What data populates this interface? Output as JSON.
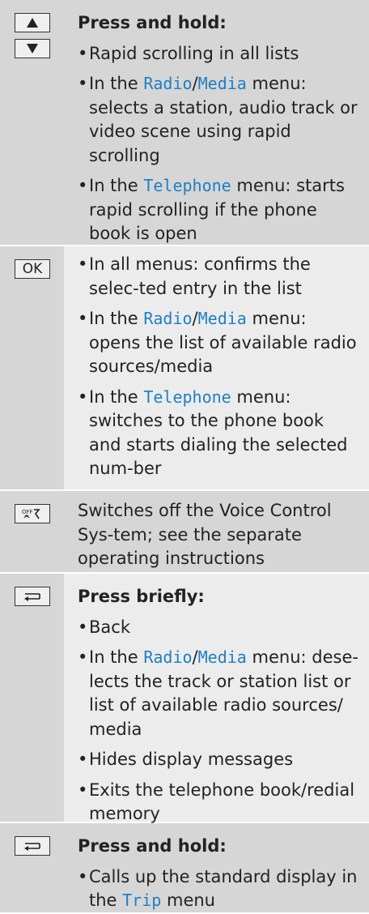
{
  "rows": [
    {
      "keys": [
        "up",
        "down"
      ],
      "heading": "Press and hold:",
      "items": [
        {
          "text": "Rapid scrolling in all lists"
        },
        {
          "pre": "In the ",
          "menu1": "Radio",
          "sep": "/",
          "menu2": "Media",
          "post": " menu: selects a station, audio track or video scene using rapid scrolling"
        },
        {
          "pre": "In the ",
          "menu1": "Telephone",
          "post": " menu: starts rapid scrolling if the phone book is open"
        }
      ]
    },
    {
      "key_label": "OK",
      "items": [
        {
          "text": "In all menus: confirms the selec-ted entry in the list"
        },
        {
          "pre": "In the ",
          "menu1": "Radio",
          "sep": "/",
          "menu2": "Media",
          "post": " menu: opens the list of available radio sources/media"
        },
        {
          "pre": "In the ",
          "menu1": "Telephone",
          "post": " menu: switches to the phone book and starts dialing the selected num-ber"
        }
      ]
    },
    {
      "key_icon": "voice-control-off-icon",
      "text": "Switches off the Voice Control Sys-tem; see the separate operating instructions"
    },
    {
      "key_icon": "back-icon",
      "heading": "Press briefly:",
      "items": [
        {
          "text": "Back"
        },
        {
          "pre": "In the ",
          "menu1": "Radio",
          "sep": "/",
          "menu2": "Media",
          "post": " menu: dese-lects the track or station list or list of available radio sources/ media"
        },
        {
          "text": "Hides display messages"
        },
        {
          "text": "Exits the telephone book/redial memory"
        }
      ]
    },
    {
      "key_icon": "back-icon",
      "heading": "Press and hold:",
      "items": [
        {
          "pre": "Calls up the standard display in the ",
          "menu1": "Trip",
          "post": " menu"
        }
      ]
    }
  ],
  "colors": {
    "menu_text": "#1f7fc4",
    "cell_shade": "#d6d6d6",
    "cell_light": "#ececec"
  }
}
